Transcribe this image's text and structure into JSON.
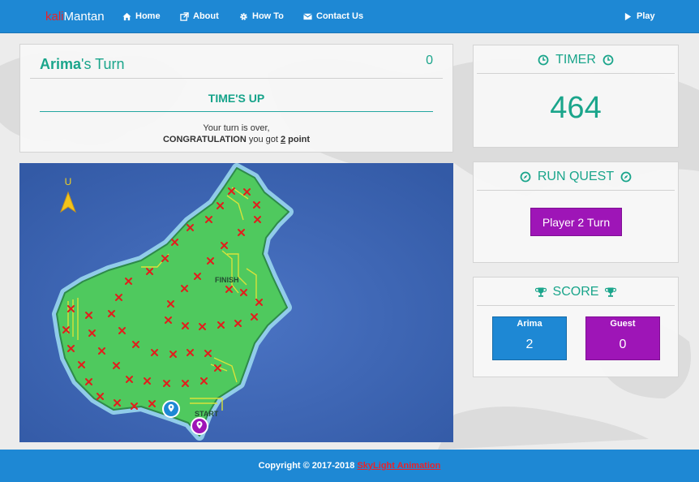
{
  "nav": {
    "brand_part1": "kali",
    "brand_part2": "Mantan",
    "home": "Home",
    "about": "About",
    "howto": "How To",
    "contact": "Contact Us",
    "play": "Play"
  },
  "turn": {
    "player_name": "Arima",
    "title_suffix": "'s Turn",
    "score": "0",
    "status": "TIME'S UP",
    "message_line1": "Your turn is over,",
    "message_bold": "CONGRATULATION",
    "message_mid": " you got ",
    "points": "2",
    "message_end": " point"
  },
  "map": {
    "compass_label": "U",
    "finish_label": "FINISH",
    "start_label": "START"
  },
  "timer": {
    "title": "TIMER",
    "value": "464"
  },
  "quest": {
    "title": "RUN QUEST",
    "button_label": "Player 2 Turn"
  },
  "score": {
    "title": "SCORE",
    "players": [
      {
        "name": "Arima",
        "value": "2"
      },
      {
        "name": "Guest",
        "value": "0"
      }
    ]
  },
  "footer": {
    "copyright": "Copyright © 2017-2018 ",
    "company": "SkyLight  Animation"
  },
  "colors": {
    "nav_blue": "#1e88d4",
    "accent_teal": "#1aa58b",
    "player2_purple": "#9e15b7",
    "brand_red": "#e8232a",
    "map_sea": "#3a63b2",
    "island_green": "#4fc95e"
  }
}
